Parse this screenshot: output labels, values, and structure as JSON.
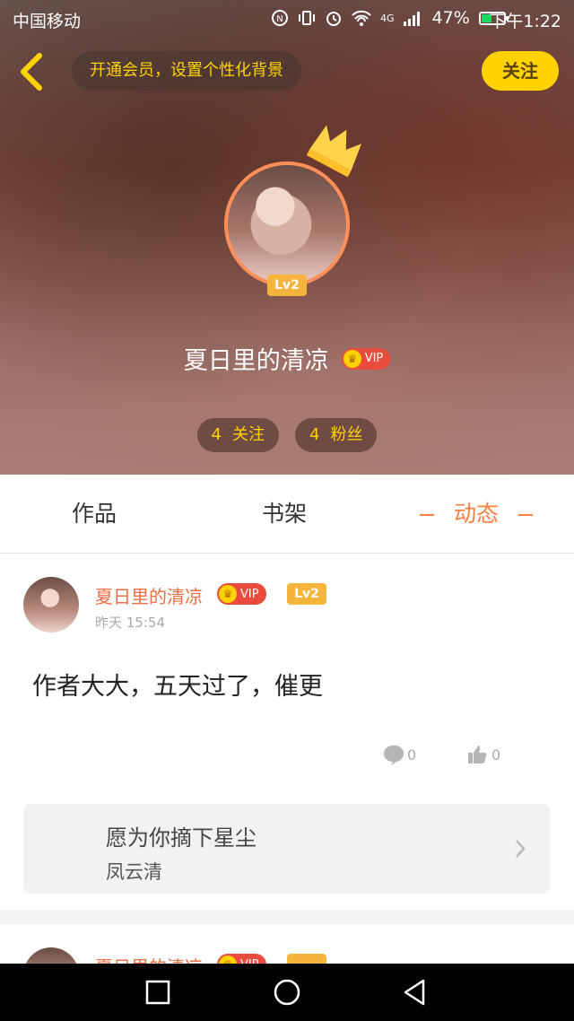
{
  "status_bar": {
    "carrier": "中国移动",
    "network": "4G",
    "battery_percent": "47%",
    "battery_level": 0.47,
    "time": "下午1:22"
  },
  "header": {
    "vip_banner": "开通会员，设置个性化背景",
    "follow_button": "关注",
    "level_badge": "Lv2",
    "username": "夏日里的清凉",
    "vip_label": "VIP",
    "stats": {
      "following_count": "4",
      "following_label": "关注",
      "fans_count": "4",
      "fans_label": "粉丝"
    }
  },
  "tabs": {
    "works": "作品",
    "shelf": "书架",
    "feed": "动态",
    "active": "feed"
  },
  "post": {
    "username": "夏日里的清凉",
    "vip_label": "VIP",
    "level": "Lv2",
    "time": "昨天 15:54",
    "text": "作者大大，五天过了，催更",
    "comment_count": "0",
    "like_count": "0",
    "book": {
      "title": "愿为你摘下星尘",
      "author": "凤云清"
    }
  },
  "post2": {
    "username": "夏日里的清凉",
    "vip_label": "VIP"
  },
  "colors": {
    "accent": "#ff7f3f",
    "yellow": "#ffd200",
    "vip_red": "#e94c3d",
    "level_gold": "#f5b53c"
  }
}
